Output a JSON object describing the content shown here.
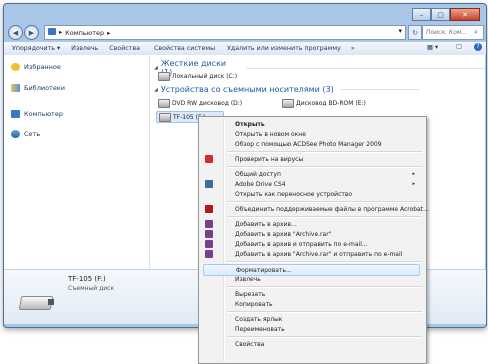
{
  "window": {
    "caption_buttons": [
      "–",
      "▢",
      "✕"
    ]
  },
  "address": {
    "back_glyph": "◀",
    "forward_glyph": "▶",
    "path": "Компьютер",
    "path_arrow": "▸",
    "search_placeholder": "Поиск: Ком...",
    "search_glyph": "⌕",
    "refresh_glyph": "↻",
    "dropdown_glyph": "▾"
  },
  "toolbar": {
    "items": [
      "Упорядочить ▾",
      "Извлечь",
      "Свойства",
      "Свойства системы",
      "Удалить или изменить программу",
      "»"
    ],
    "view_glyph": "▦ ▾",
    "pane_glyph": "▢",
    "help_glyph": "?"
  },
  "nav": {
    "items": [
      {
        "label": "Избранное",
        "icon": "star-icon"
      },
      {
        "label": "Библиотеки",
        "icon": "libraries-icon"
      },
      {
        "label": "Компьютер",
        "icon": "computer-icon"
      },
      {
        "label": "Сеть",
        "icon": "network-icon"
      }
    ]
  },
  "groups": {
    "hdd": {
      "title": "Жесткие диски (1)",
      "glyph": "◢"
    },
    "removable": {
      "title": "Устройства со съемными носителями (3)",
      "glyph": "◢"
    }
  },
  "drives": {
    "local_c": "Локальный диск (C:)",
    "dvd_d": "DVD RW дисковод (D:)",
    "bd_e": "Дисковод BD-ROM (E:)",
    "tf_f": "TF-105 (F:)"
  },
  "details": {
    "name": "TF-105 (F:)",
    "type": "Съемный диск"
  },
  "context_menu": {
    "items": [
      {
        "label": "Открыть",
        "bold": true
      },
      {
        "label": "Открыть в новом окне"
      },
      {
        "label": "Обзор с помощью ACDSee Photo Manager 2009"
      },
      {
        "label": "Проверить на вирусы",
        "icon": "kaspersky-icon"
      },
      {
        "label": "Общий доступ",
        "submenu": true
      },
      {
        "label": "Adobe Drive CS4",
        "icon": "adobe-drive-icon",
        "submenu": true
      },
      {
        "label": "Открыть как переносное устройство"
      },
      {
        "label": "Объединить поддерживаемые файлы в программе Acrobat...",
        "icon": "acrobat-icon"
      },
      {
        "label": "Добавить в архив...",
        "icon": "winrar-icon"
      },
      {
        "label": "Добавить в архив \"Archive.rar\"",
        "icon": "winrar-icon"
      },
      {
        "label": "Добавить в архив и отправить по e-mail...",
        "icon": "winrar-icon"
      },
      {
        "label": "Добавить в архив \"Archive.rar\" и отправить по e-mail",
        "icon": "winrar-icon"
      },
      {
        "label": "Форматировать...",
        "highlighted": true
      },
      {
        "label": "Извлечь"
      },
      {
        "label": "Вырезать"
      },
      {
        "label": "Копировать"
      },
      {
        "label": "Создать ярлык"
      },
      {
        "label": "Переименовать"
      },
      {
        "label": "Свойства"
      }
    ],
    "submenu_glyph": "▸"
  },
  "colors": {
    "accent": "#1e5aa0",
    "highlight": "#dbe9fb",
    "frame": "#a9c6e6"
  }
}
